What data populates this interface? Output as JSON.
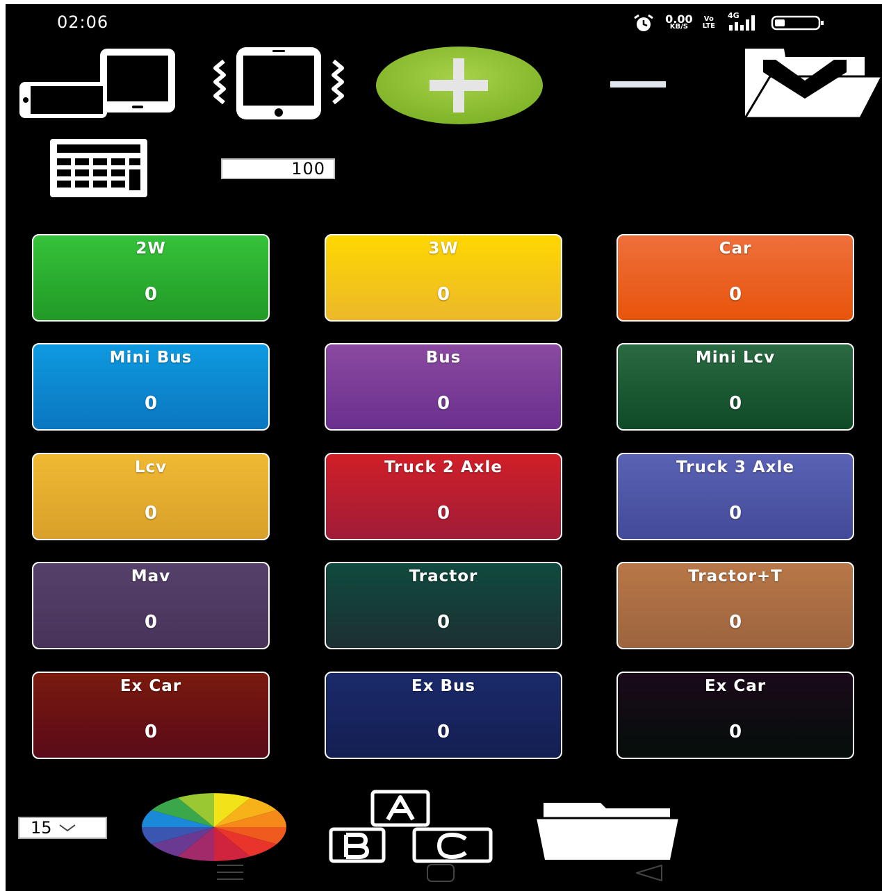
{
  "status_bar": {
    "time": "02:06",
    "net_speed_value": "0.00",
    "net_speed_unit": "KB/S",
    "volte_top": "Vo",
    "volte_bottom": "LTE",
    "network_type": "4G"
  },
  "toolbar": {
    "icons": [
      "rotate-screen-icon",
      "vibrate-icon",
      "add-icon",
      "minus-icon",
      "save-folder-icon",
      "calculator-icon"
    ]
  },
  "amount_input": {
    "value": "100"
  },
  "tiles": [
    {
      "label": "2W",
      "count": "0",
      "color_top": "#36c23a",
      "color_bottom": "#219a26"
    },
    {
      "label": "3W",
      "count": "0",
      "color_top": "#ffd700",
      "color_bottom": "#ecb82a"
    },
    {
      "label": "Car",
      "count": "0",
      "color_top": "#ee6f3c",
      "color_bottom": "#e8540b"
    },
    {
      "label": "Mini Bus",
      "count": "0",
      "color_top": "#0e9ae0",
      "color_bottom": "#0a76c0"
    },
    {
      "label": "Bus",
      "count": "0",
      "color_top": "#8a4aa0",
      "color_bottom": "#6a2f8e"
    },
    {
      "label": "Mini Lcv",
      "count": "0",
      "color_top": "#2a6a42",
      "color_bottom": "#0e4a26"
    },
    {
      "label": "Lcv",
      "count": "0",
      "color_top": "#f0b932",
      "color_bottom": "#d8a02a"
    },
    {
      "label": "Truck 2 Axle",
      "count": "0",
      "color_top": "#d01f28",
      "color_bottom": "#a01c38"
    },
    {
      "label": "Truck 3 Axle",
      "count": "0",
      "color_top": "#5a62b4",
      "color_bottom": "#424a98"
    },
    {
      "label": "Mav",
      "count": "0",
      "color_top": "#55406a",
      "color_bottom": "#48345a"
    },
    {
      "label": "Tractor",
      "count": "0",
      "color_top": "#104a3e",
      "color_bottom": "#1c3032"
    },
    {
      "label": "Tractor+T",
      "count": "0",
      "color_top": "#b87748",
      "color_bottom": "#9c643e"
    },
    {
      "label": "Ex Car",
      "count": "0",
      "color_top": "#7a1a0e",
      "color_bottom": "#5a0a1a"
    },
    {
      "label": "Ex Bus",
      "count": "0",
      "color_top": "#1a2a6a",
      "color_bottom": "#141e52"
    },
    {
      "label": "Ex Car",
      "count": "0",
      "color_top": "#1a0a1a",
      "color_bottom": "#050e0a"
    }
  ],
  "bottom": {
    "font_size_value": "15",
    "icons": [
      "color-wheel-icon",
      "abc-blocks-icon",
      "open-folder-icon"
    ]
  }
}
